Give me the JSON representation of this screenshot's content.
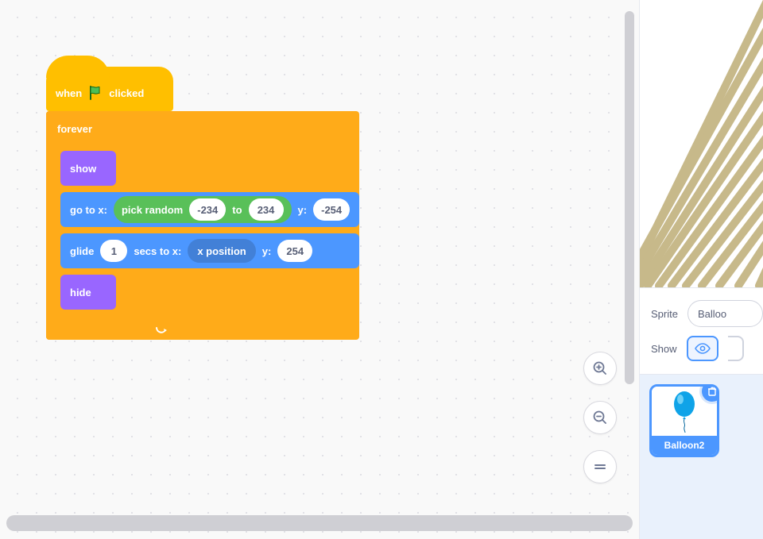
{
  "script": {
    "hat": {
      "prefix": "when",
      "suffix": "clicked"
    },
    "forever_label": "forever",
    "show_label": "show",
    "goto": {
      "label_goto_x": "go to x:",
      "label_y": "y:",
      "random_prefix": "pick random",
      "random_to": "to",
      "rand_min": "-234",
      "rand_max": "234",
      "y_value": "-254"
    },
    "glide": {
      "label_glide": "glide",
      "secs": "1",
      "label_secs_to_x": "secs to x:",
      "x_reporter": "x position",
      "label_y": "y:",
      "y_value": "254"
    },
    "hide_label": "hide"
  },
  "info": {
    "sprite_label": "Sprite",
    "sprite_name": "Balloo",
    "show_label": "Show"
  },
  "sprite_tile": {
    "name": "Balloon2"
  },
  "zoom": {
    "in": "zoom-in",
    "out": "zoom-out",
    "reset": "zoom-reset"
  }
}
